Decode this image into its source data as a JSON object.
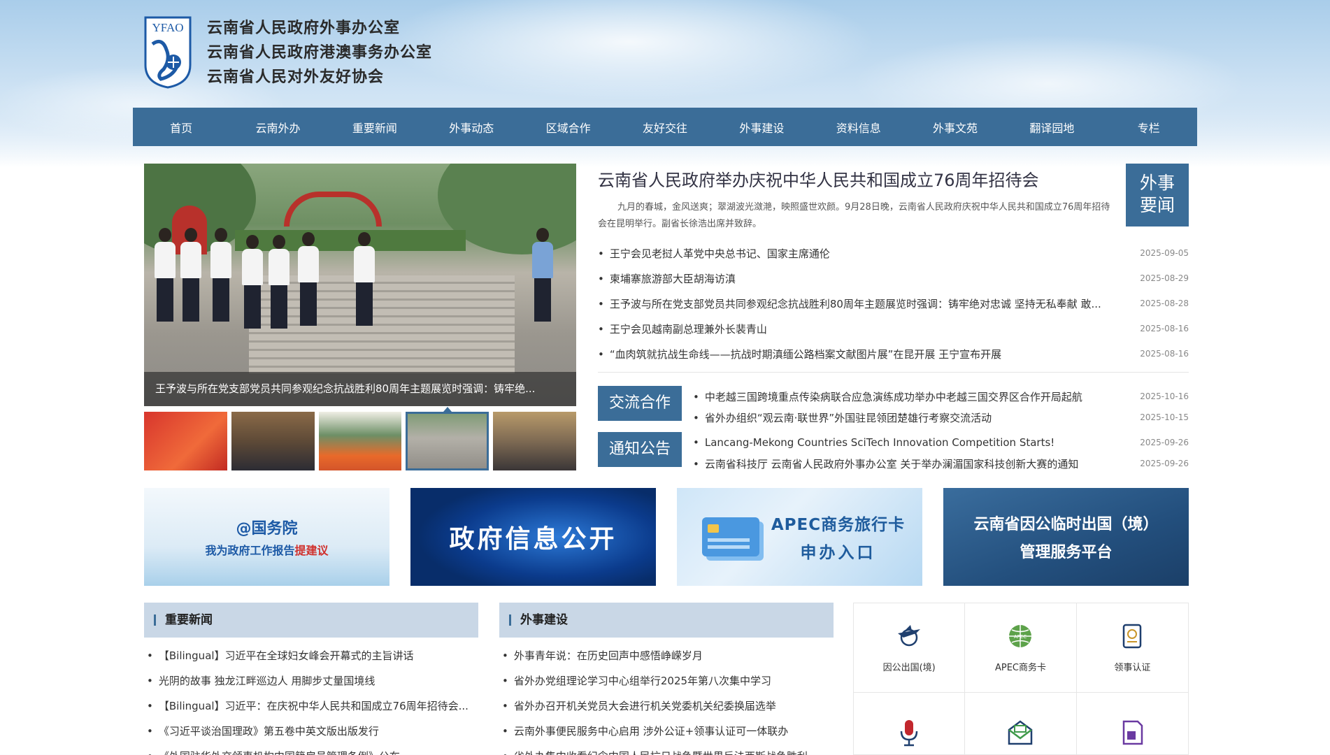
{
  "header": {
    "logo_text": "YFAO",
    "org_names": [
      "云南省人民政府外事办公室",
      "云南省人民政府港澳事务办公室",
      "云南省人民对外友好协会"
    ]
  },
  "nav": [
    "首页",
    "云南外办",
    "重要新闻",
    "外事动态",
    "区域合作",
    "友好交往",
    "外事建设",
    "资料信息",
    "外事文苑",
    "翻译园地",
    "专栏"
  ],
  "slider": {
    "caption": "王予波与所在党支部党员共同参观纪念抗战胜利80周年主题展览时强调：铸牢绝...",
    "thumbs_count": 5,
    "active_thumb": 4
  },
  "headline": {
    "title": "云南省人民政府举办庆祝中华人民共和国成立76周年招待会",
    "summary": "九月的春城，金风送爽；翠湖波光潋滟，映照盛世欢颜。9月28日晚，云南省人民政府庆祝中华人民共和国成立76周年招待会在昆明举行。副省长徐浩出席并致辞。",
    "tag": [
      "外事",
      "要闻"
    ]
  },
  "top_news": [
    {
      "title": "王宁会见老挝人革党中央总书记、国家主席通伦",
      "date": "2025-09-05"
    },
    {
      "title": "柬埔寨旅游部大臣胡海访滇",
      "date": "2025-08-29"
    },
    {
      "title": "王予波与所在党支部党员共同参观纪念抗战胜利80周年主题展览时强调：铸牢绝对忠诚 坚持无私奉献 敢...",
      "date": "2025-08-28"
    },
    {
      "title": "王宁会见越南副总理兼外长裴青山",
      "date": "2025-08-16"
    },
    {
      "title": "“血肉筑就抗战生命线——抗战时期滇缅公路档案文献图片展”在昆开展 王宁宣布开展",
      "date": "2025-08-16"
    }
  ],
  "exchange": {
    "tag": "交流合作",
    "items": [
      {
        "title": "中老越三国跨境重点传染病联合应急演练成功举办中老越三国交界区合作开局起航",
        "date": "2025-10-16"
      },
      {
        "title": "省外办组织“观云南·联世界”外国驻昆领团楚雄行考察交流活动",
        "date": "2025-10-15"
      }
    ]
  },
  "notice": {
    "tag": "通知公告",
    "items": [
      {
        "title": "Lancang-Mekong Countries SciTech Innovation Competition Starts!",
        "date": "2025-09-26"
      },
      {
        "title": "云南省科技厅 云南省人民政府外事办公室 关于举办澜湄国家科技创新大赛的通知",
        "date": "2025-09-26"
      }
    ]
  },
  "banners": {
    "b1": {
      "line1": "@国务院",
      "line2_prefix": "我为政府工作报告",
      "line2_em": "提建议"
    },
    "b2": {
      "line1": "政府信息公开"
    },
    "b3": {
      "line1": "APEC商务旅行卡",
      "line2": "申办入口"
    },
    "b4": {
      "line1": "云南省因公临时出国（境）",
      "line2": "管理服务平台"
    }
  },
  "important_news": {
    "title": "重要新闻",
    "items": [
      "【Bilingual】习近平在全球妇女峰会开幕式的主旨讲话",
      "光阴的故事 独龙江畔巡边人 用脚步丈量国境线",
      "【Bilingual】习近平：在庆祝中华人民共和国成立76周年招待会...",
      "《习近平谈治国理政》第五卷中英文版出版发行",
      "《外国驻华外交领事机构中国籍雇员管理条例》公布"
    ]
  },
  "foreign_affairs": {
    "title": "外事建设",
    "items": [
      "外事青年说：在历史回声中感悟峥嵘岁月",
      "省外办党组理论学习中心组举行2025年第八次集中学习",
      "省外办召开机关党员大会进行机关党委机关纪委换届选举",
      "云南外事便民服务中心启用 涉外公证+领事认证可一体联办",
      "省外办集中收看纪念中国人民抗日战争暨世界反法西斯战争胜利"
    ]
  },
  "services": [
    {
      "label": "因公出国(境)",
      "icon": "plane-globe-icon"
    },
    {
      "label": "APEC商务卡",
      "icon": "apec-globe-icon"
    },
    {
      "label": "领事认证",
      "icon": "passport-icon"
    },
    {
      "label": "",
      "icon": "microphone-icon"
    },
    {
      "label": "",
      "icon": "mail-icon"
    },
    {
      "label": "",
      "icon": "document-icon"
    }
  ],
  "colors": {
    "nav_bg": "#3b6d98",
    "accent": "#3b6d98",
    "section_head_bg": "#c9d7e6"
  }
}
